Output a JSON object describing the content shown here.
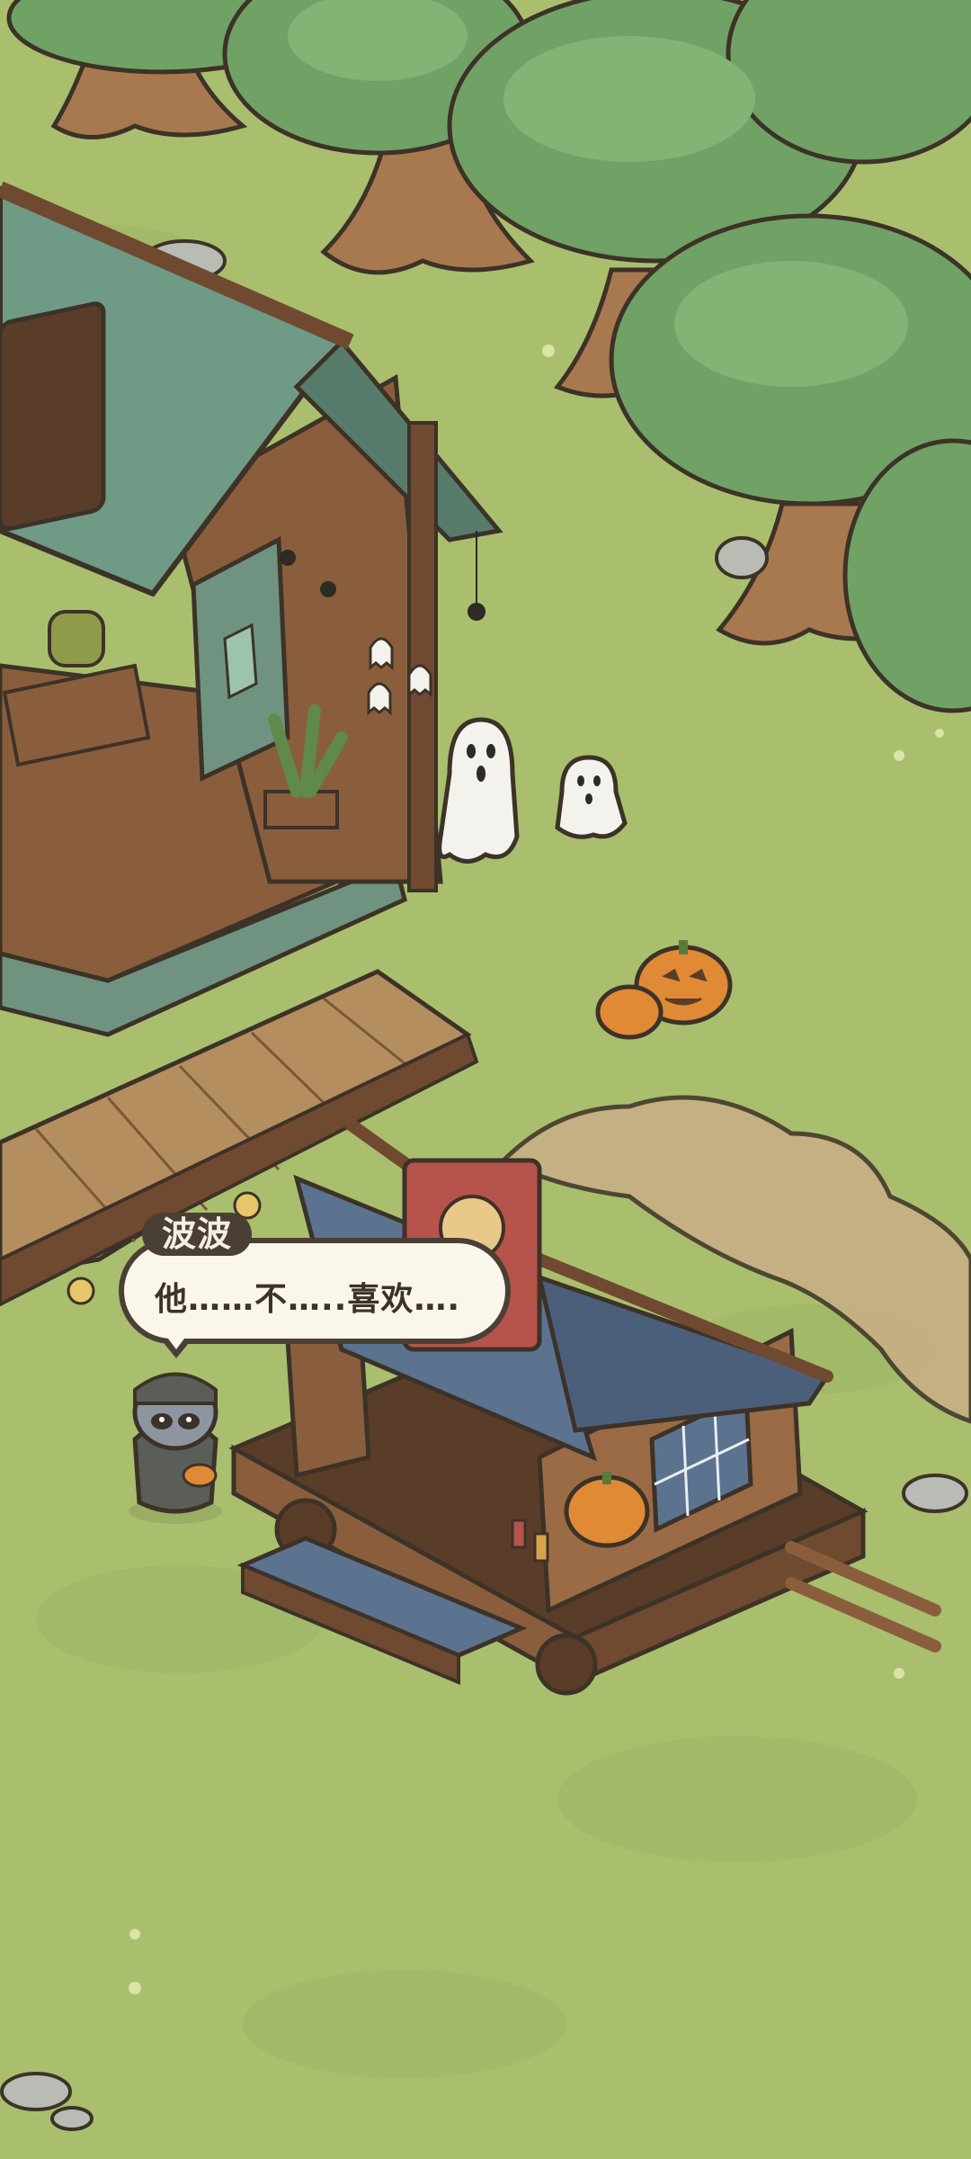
{
  "dialog": {
    "speaker": "波波",
    "line": "他……不…..喜欢…."
  },
  "colors": {
    "grass": "#a9bf6e",
    "grass_dark": "#98b060",
    "tree_green": "#6fa264",
    "tree_dark": "#4f7e4d",
    "trunk": "#a8794f",
    "roof_green": "#6f9a86",
    "roof_blue": "#5c7390",
    "wood": "#8a5e3c",
    "wood_dark": "#5a3d28",
    "ghost": "#f4f2ec",
    "pumpkin": "#e08a35",
    "outline": "#3d3228"
  },
  "icons": [
    "ghost-icon",
    "pumpkin-icon",
    "spider-icon",
    "raccoon-character"
  ]
}
